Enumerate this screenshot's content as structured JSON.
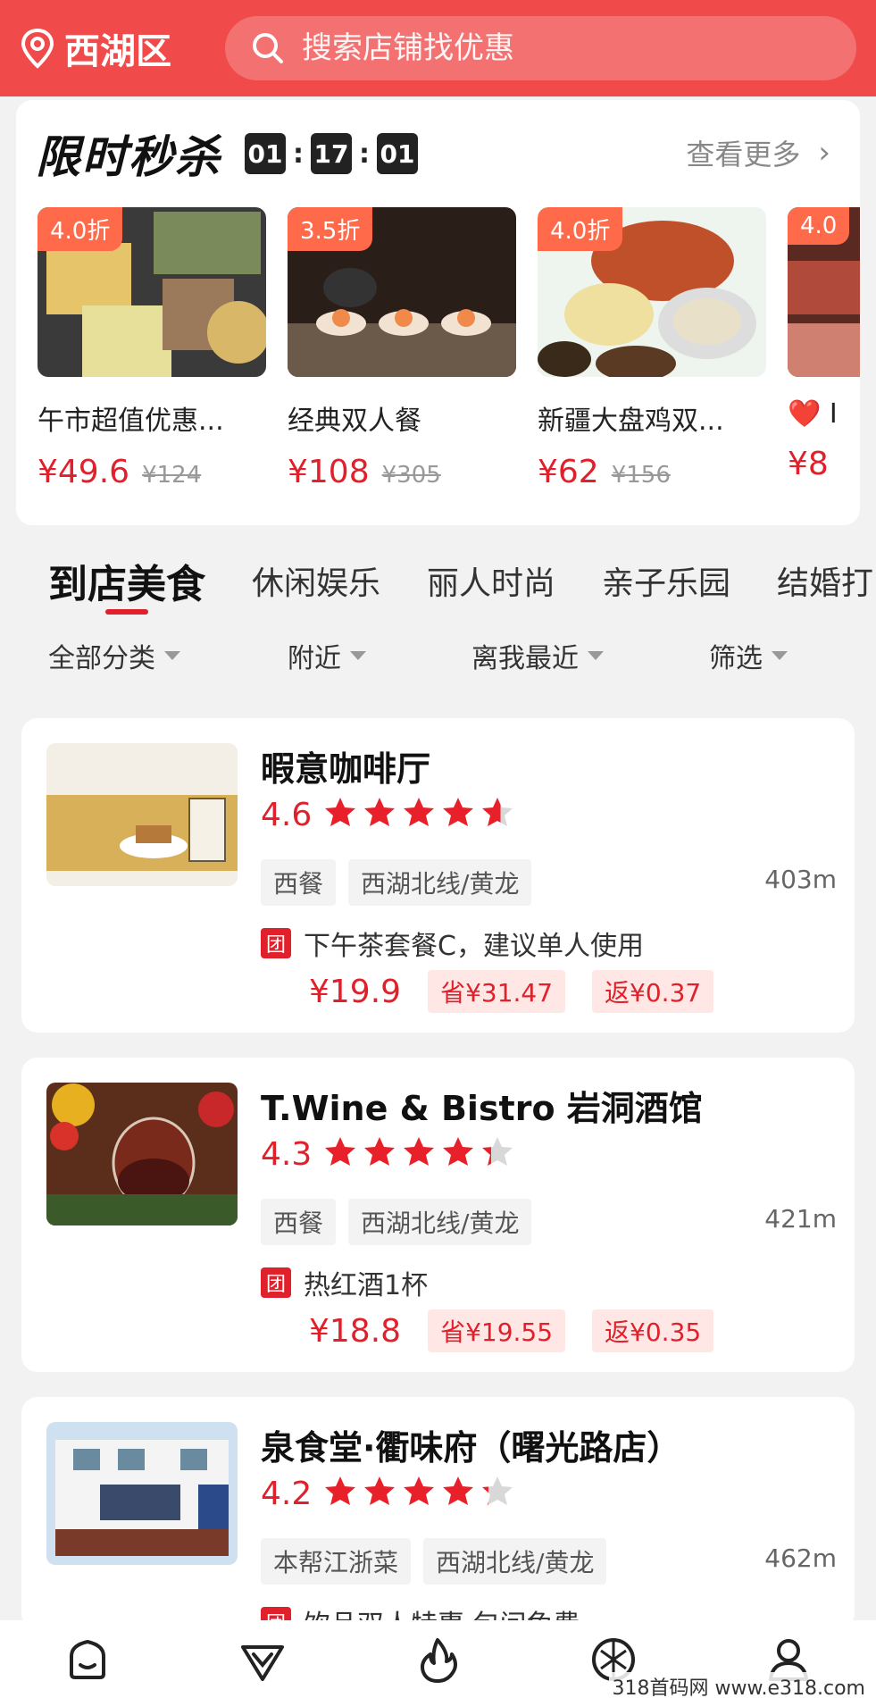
{
  "header": {
    "city": "西湖区",
    "search_placeholder": "搜索店铺找优惠"
  },
  "flash_sale": {
    "title": "限时秒杀",
    "timer": {
      "h": "01",
      "m": "17",
      "s": "01"
    },
    "more_label": "查看更多",
    "items": [
      {
        "discount": "4.0折",
        "name": "午市超值优惠...",
        "price": "¥49.6",
        "original": "¥124"
      },
      {
        "discount": "3.5折",
        "name": "经典双人餐",
        "price": "¥108",
        "original": "¥305"
      },
      {
        "discount": "4.0折",
        "name": "新疆大盘鸡双...",
        "price": "¥62",
        "original": "¥156"
      },
      {
        "discount": "4.0",
        "name": "❤️ I",
        "price": "¥8",
        "original": ""
      }
    ]
  },
  "category_tabs": [
    "到店美食",
    "休闲娱乐",
    "丽人时尚",
    "亲子乐园",
    "结婚打"
  ],
  "filters": [
    "全部分类",
    "附近",
    "离我最近",
    "筛选"
  ],
  "shops": [
    {
      "name": "暇意咖啡厅",
      "rating": "4.6",
      "stars": 4.6,
      "tags": [
        "西餐",
        "西湖北线/黄龙"
      ],
      "distance": "403m",
      "deal_badge": "团",
      "deal": "下午茶套餐C，建议单人使用",
      "price": "¥19.9",
      "save": "省¥31.47",
      "cashback": "返¥0.37"
    },
    {
      "name": "T.Wine & Bistro 岩洞酒馆",
      "rating": "4.3",
      "stars": 4.3,
      "tags": [
        "西餐",
        "西湖北线/黄龙"
      ],
      "distance": "421m",
      "deal_badge": "团",
      "deal": "热红酒1杯",
      "price": "¥18.8",
      "save": "省¥19.55",
      "cashback": "返¥0.35"
    },
    {
      "name": "泉食堂·衢味府（曙光路店）",
      "rating": "4.2",
      "stars": 4.2,
      "tags": [
        "本帮江浙菜",
        "西湖北线/黄龙"
      ],
      "distance": "462m",
      "deal_badge": "团",
      "deal": "饮品双人特惠 包间免费",
      "price": "",
      "save": "",
      "cashback": ""
    }
  ],
  "watermark": "318首码网 www.e318.com",
  "colors": {
    "brand_red": "#f04a4a",
    "price_red": "#e0202a"
  }
}
